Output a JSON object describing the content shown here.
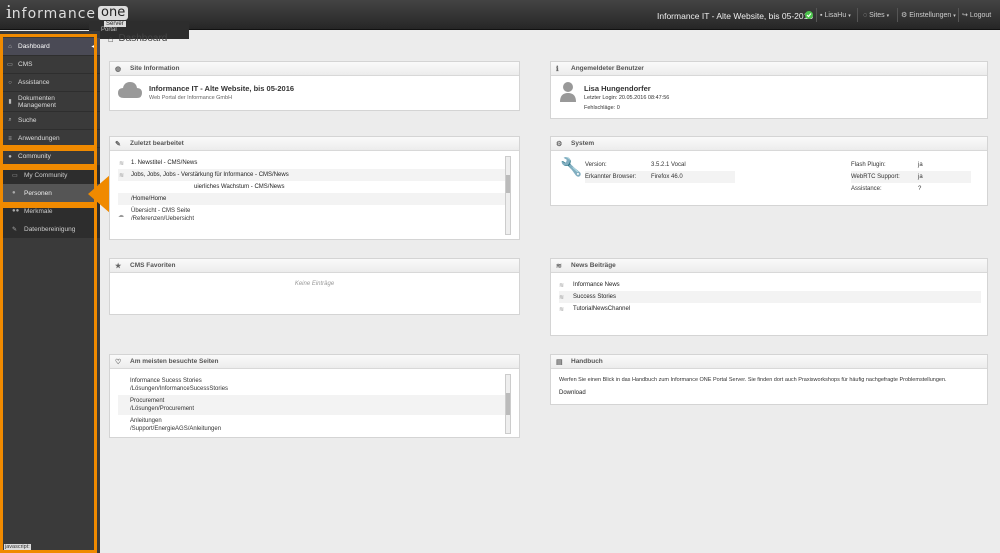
{
  "topbar": {
    "logo_main": "nformance",
    "logo_i": "i",
    "logo_one": "one",
    "logo_portal": "Portal",
    "logo_server": "Server",
    "site_title": "Informance IT - Alte Website, bis 05-2016",
    "user": "LisaHu",
    "sites": "Sites",
    "settings": "Einstellungen",
    "logout": "Logout",
    "status_color": "#4cc34c"
  },
  "sidebar": {
    "items": [
      {
        "label": "Dashboard",
        "icon": "home-icon"
      },
      {
        "label": "CMS",
        "icon": "folder-icon"
      },
      {
        "label": "Assistance",
        "icon": "chat-icon"
      },
      {
        "label": "Dokumenten Management",
        "icon": "bookmark-icon"
      },
      {
        "label": "Suche",
        "icon": "search-icon"
      },
      {
        "label": "Anwendungen",
        "icon": "list-icon"
      },
      {
        "label": "Community",
        "icon": "user-icon"
      }
    ],
    "sub_items": [
      {
        "label": "My Community",
        "icon": "monitor-icon"
      },
      {
        "label": "Personen",
        "icon": "user-icon"
      },
      {
        "label": "Merkmale",
        "icon": "users-icon"
      },
      {
        "label": "Datenbereinigung",
        "icon": "brush-icon"
      }
    ],
    "status_tag": "javascript:",
    "highlight_color": "#f08a00"
  },
  "page_title": "Dashboard",
  "site_info": {
    "title": "Site Information",
    "name": "Informance IT - Alte Website, bis 05-2016",
    "desc": "Web Portal der Informance GmbH"
  },
  "user_panel": {
    "title": "Angemeldeter Benutzer",
    "name": "Lisa Hungendorfer",
    "last_login": "Letzter Login: 20.05.2016 08:47:56",
    "failures": "Fehlschläge: 0"
  },
  "recent": {
    "title": "Zuletzt bearbeitet",
    "items": [
      "1. Newstitel - CMS/News",
      "Jobs, Jobs, Jobs - Verstärkung für Informance - CMS/News",
      "uierliches Wachstum - CMS/News",
      "/Home/Home",
      "Übersicht - CMS Seite",
      "/Referenzen/Uebersicht"
    ]
  },
  "system": {
    "title": "System",
    "rows": [
      {
        "label": "Version:",
        "value": "3.5.2.1 Vocal"
      },
      {
        "label": "Erkannter Browser:",
        "value": "Firefox 46.0"
      }
    ],
    "right_rows": [
      {
        "label": "Flash Plugin:",
        "value": "ja"
      },
      {
        "label": "WebRTC Support:",
        "value": "ja"
      },
      {
        "label": "Assistance:",
        "value": "?"
      }
    ]
  },
  "favorites": {
    "title": "CMS Favoriten",
    "empty": "Keine Einträge"
  },
  "news": {
    "title": "News Beiträge",
    "items": [
      "Informance News",
      "Success Stories",
      "TutorialNewsChannel"
    ]
  },
  "visited": {
    "title": "Am meisten besuchte Seiten",
    "items": [
      {
        "name": "Informance Sucess Stories",
        "path": "/Lösungen/InformanceSucessStories"
      },
      {
        "name": "Procurement",
        "path": "/Lösungen/Procurement"
      },
      {
        "name": "Anleitungen",
        "path": "/Support/EnergieAGS/Anleitungen"
      }
    ]
  },
  "manual": {
    "title": "Handbuch",
    "text": "Werfen Sie einen Blick in das Handbuch zum Informance ONE Portal Server. Sie finden dort auch Praxisworkshops für häufig nachgefragte Problemstellungen.",
    "link": "Download"
  }
}
